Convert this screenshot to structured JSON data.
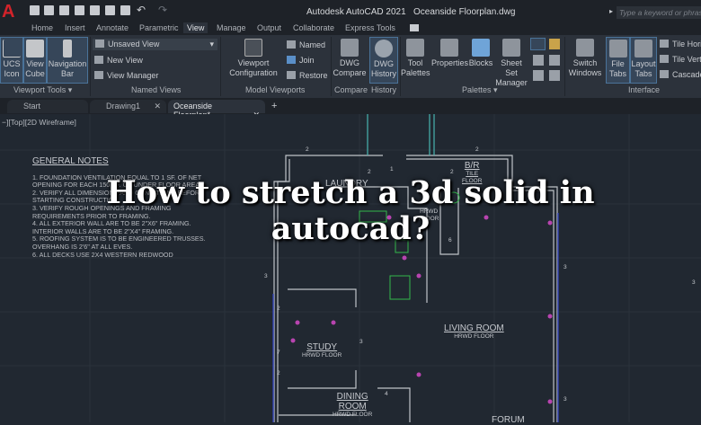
{
  "app": {
    "title": "Autodesk AutoCAD 2021",
    "file": "Oceanside Floorplan.dwg",
    "search_placeholder": "Type a keyword or phrase",
    "logo": "A"
  },
  "ribbon_tabs": [
    "Home",
    "Insert",
    "Annotate",
    "Parametric",
    "View",
    "Manage",
    "Output",
    "Collaborate",
    "Express Tools"
  ],
  "active_tab": "View",
  "ribbon": {
    "viewport_tools": {
      "title": "Viewport Tools",
      "buttons": [
        [
          "UCS",
          "Icon"
        ],
        [
          "View",
          "Cube"
        ],
        [
          "Navigation",
          "Bar"
        ]
      ]
    },
    "named_views": {
      "title": "Named Views",
      "dropdown": "Unsaved View",
      "new_view": "New View",
      "view_manager": "View Manager"
    },
    "model_viewports": {
      "title": "Model Viewports",
      "config": [
        "Viewport",
        "Configuration"
      ],
      "named": "Named",
      "join": "Join",
      "restore": "Restore"
    },
    "compare": {
      "title": "Compare",
      "button": [
        "DWG",
        "Compare"
      ]
    },
    "history": {
      "title": "History",
      "button": [
        "DWG",
        "History"
      ]
    },
    "palettes": {
      "title": "Palettes",
      "tool": [
        "Tool",
        "Palettes"
      ],
      "properties": "Properties",
      "blocks": "Blocks",
      "sheetset": [
        "Sheet Set",
        "Manager"
      ]
    },
    "interface": {
      "title": "Interface",
      "switch": [
        "Switch",
        "Windows"
      ],
      "file_tabs": [
        "File",
        "Tabs"
      ],
      "layout_tabs": [
        "Layout",
        "Tabs"
      ],
      "tile_h": "Tile Horizontally",
      "tile_v": "Tile Vertically",
      "cascade": "Cascade"
    }
  },
  "doc_tabs": [
    "Start",
    "Drawing1",
    "Oceanside Floorplan*"
  ],
  "viewport_label": "−][Top][2D Wireframe]",
  "notes": {
    "title": "GENERAL NOTES",
    "items": [
      "1.  FOUNDATION VENTILATION EQUAL TO 1 SF. OF NET",
      "     OPENING FOR EACH 150 SF. OF UNDER FLOOR AREA.",
      "2.  VERIFY ALL DIMENSIONS AND CONDITIONS BEFORE",
      "     STARTING CONSTRUCTION.",
      "3.  VERIFY ROUGH OPENINGS AND FRAMING",
      "     REQUIREMENTS PRIOR TO FRAMING.",
      "4.  ALL EXTERIOR WALL ARE TO BE 2\"X6\" FRAMING.",
      "     INTERIOR WALLS ARE TO BE 2\"X4\" FRAMING.",
      "5.  ROOFING SYSTEM IS TO BE ENGINEERED TRUSSES.",
      "     OVERHANG IS 2'6\" AT ALL EVES.",
      "6.  ALL DECKS USE 2X4 WESTERN REDWOOD"
    ]
  },
  "rooms": {
    "laundry": "LAUNDRY",
    "br": "B/R",
    "br_floor": [
      "TILE",
      "FLOOR"
    ],
    "hall_floor": [
      "HRWD",
      "FLOOR"
    ],
    "living": "LIVING  ROOM",
    "living_floor": "HRWD  FLOOR",
    "study": "STUDY",
    "study_floor": "HRWD  FLOOR",
    "dining": [
      "DINING",
      "ROOM"
    ],
    "dining_floor": "HRWD  FLOOR",
    "forum": "FORUM"
  },
  "dims": [
    "2",
    "2",
    "2",
    "1",
    "2",
    "6",
    "3",
    "3",
    "3",
    "2",
    "7",
    "2",
    "3",
    "4",
    "3"
  ],
  "headline": [
    "How to stretch a 3d solid in",
    "autocad?"
  ],
  "colors": {
    "canvas": "#212831",
    "ribbon": "#2c323b",
    "accent": "#4a7399",
    "logo": "#d2232a"
  }
}
